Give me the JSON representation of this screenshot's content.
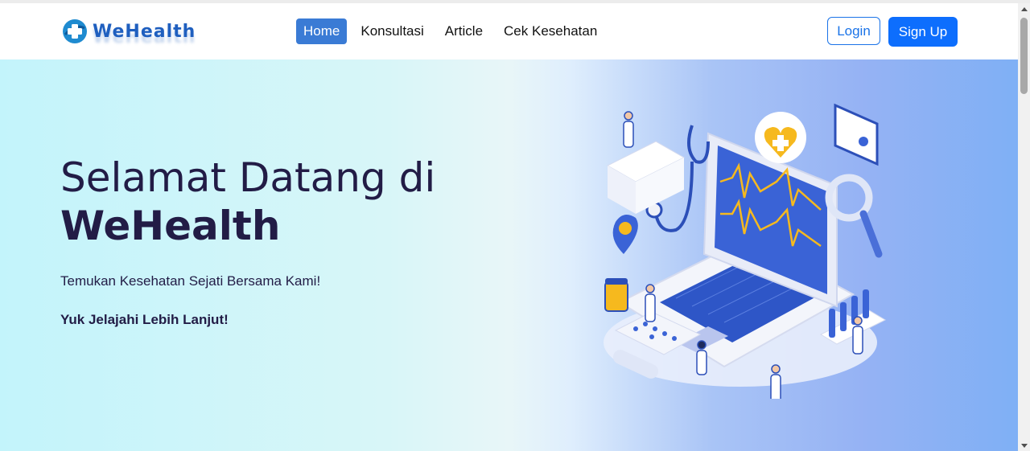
{
  "brand": {
    "name": "WeHealth",
    "logo_icon": "medical-cross-globe-icon",
    "color": "#1f5fbf"
  },
  "nav": {
    "items": [
      {
        "label": "Home",
        "active": true
      },
      {
        "label": "Konsultasi",
        "active": false
      },
      {
        "label": "Article",
        "active": false
      },
      {
        "label": "Cek Kesehatan",
        "active": false
      }
    ],
    "active_color": "#3a7bd5"
  },
  "auth": {
    "login_label": "Login",
    "signup_label": "Sign Up",
    "accent": "#0d6efd"
  },
  "hero": {
    "title_line1": "Selamat Datang di",
    "title_line2": "WeHealth",
    "subtitle": "Temukan Kesehatan Sejati Bersama Kami!",
    "cta": "Yuk Jelajahi Lebih Lanjut!",
    "illustration": "healthcare-laptop-illustration",
    "text_color": "#221c46"
  }
}
